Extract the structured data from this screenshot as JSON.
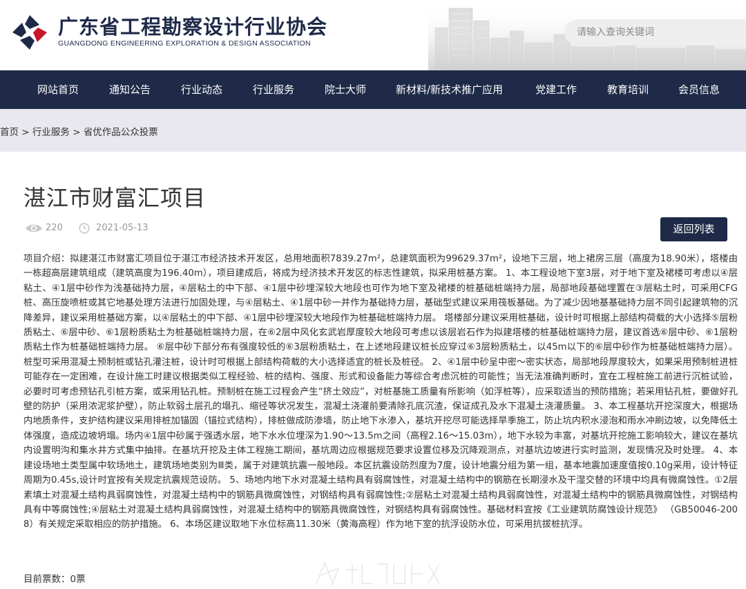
{
  "header": {
    "org_name_cn": "广东省工程勘察设计行业协会",
    "org_name_en": "GUANGDONG ENGINEERING EXPLORATION & DESIGN ASSOCIATION",
    "logo_icon": "association-logo",
    "search_placeholder": "请输入查询关键词"
  },
  "nav": {
    "items": [
      {
        "label": "网站首页"
      },
      {
        "label": "通知公告"
      },
      {
        "label": "行业动态"
      },
      {
        "label": "行业服务"
      },
      {
        "label": "院士大师"
      },
      {
        "label": "新材料/新技术推广应用"
      },
      {
        "label": "党建工作"
      },
      {
        "label": "教育培训"
      },
      {
        "label": "会员信息"
      }
    ]
  },
  "breadcrumb": {
    "items": [
      "首页",
      "行业服务",
      "省优作品公众投票"
    ],
    "separator": " > "
  },
  "article": {
    "title": "湛江市财富汇项目",
    "views": "220",
    "date": "2021-05-13",
    "back_label": "返回列表",
    "body": "项目介绍：拟建湛江市财富汇项目位于湛江市经济技术开发区，总用地面积7839.27m²，总建筑面积为99629.37m²，设地下三层，地上裙房三层（高度为18.90米），塔楼由一栋超高层建筑组成（建筑高度为196.40m），项目建成后，将成为经济技术开发区的标志性建筑，拟采用桩基方案。 1、本工程设地下室3层，对于地下室及裙楼可考虑以④层粘土、④1层中砂作为浅基础持力层，④层粘土的中下部、④1层中砂埋深较大地段也可作为地下室及裙楼的桩基础桩端持力层，局部地段基础埋置在③层粘土时，可采用CFG桩、高压旋喷桩或其它地基处理方法进行加固处理，与④层粘土、④1层中砂一并作为基础持力层，基础型式建议采用筏板基础。为了减少因地基基础持力层不同引起建筑物的沉降差异，建议采用桩基础方案，以④层粘土的中下部、④1层中砂埋深较大地段作为桩基础桩端持力层。 塔楼部分建议采用桩基础，设计时可根据上部结构荷载的大小选择⑤层粉质粘土、⑥层中砂、⑥1层粉质粘土为桩基础桩端持力层，在⑥2层中风化玄武岩厚度较大地段可考虑以该层岩石作为拟建塔楼的桩基础桩端持力层，建议首选⑥层中砂、⑥1层粉质粘土作为桩基础桩端持力层。 ⑥层中砂下部分布有强度较低的⑥3层粉质粘土，在上述地段建议桩长应穿过⑥3层粉质粘土，以45m以下的⑥层中砂作为桩基础桩端持力层）。桩型可采用混凝土预制桩或钻孔灌注桩，设计时可根据上部结构荷载的大小选择适宜的桩长及桩径。 2、④1层中砂呈中密～密实状态，局部地段厚度较大，如果采用预制桩进桩可能存在一定困难，在设计施工时建议根据类似工程经验、桩的结构、强度、形式和设备能力等综合考虑沉桩的可能性；当无法准确判断时，宜在工程桩施工前进行沉桩试验，必要时可考虑预钻孔引桩方案，或采用钻孔桩。预制桩在施工过程会产生“挤土效应”，对桩基施工质量有所影响（如浮桩等），应采取适当的预防措施；若采用钻孔桩，要做好孔壁的防护（采用浓泥浆护壁），防止软弱土层孔的塌孔、缩径等状况发生，混凝土浇灌前要清除孔底沉渣，保证成孔及水下混凝土浇灌质量。 3、本工程基坑开挖深度大，根据场内地质条件，支护结构建议采用排桩加锚固（锚拉式结构），排桩做成防渗墙，防止地下水渗入，基坑开挖尽可能选择旱季施工，防止坑内积水浸泡和雨水冲刷边坡，以免降低土体强度，造成边坡坍塌。场内④1层中砂属于强透水层，地下水水位埋深为1.90～13.5m之间（高程2.16～15.03m），地下水较为丰富，对基坑开挖施工影响较大，建议在基坑内设置明沟和集水井方式集中抽排。在基坑开挖及主体工程施工期间，基坑周边应根据规范要求设置位移及沉降观测点，对基坑边坡进行实时监测，发现情况及时处理。 4、本建设场地土类型属中软场地土，建筑场地类别为Ⅲ类，属于对建筑抗震一般地段。本区抗震设防烈度为7度，设计地震分组为第一组，基本地震加速度值按0.10g采用，设计特征周期为0.45s,设计时宜按有关规定抗震规范设防。 5、场地内地下水对混凝土结构具有弱腐蚀性，对混凝土结构中的钢筋在长期浸水及干湿交替的环境中均具有微腐蚀性。①2层素填土对混凝土结构具弱腐蚀性，对混凝土结构中的钢筋具微腐蚀性，对钢结构具有弱腐蚀性;②层粘土对混凝土结构具弱腐蚀性，对混凝土结构中的钢筋具微腐蚀性，对钢结构具有中等腐蚀性;④层粘土对混凝土结构具弱腐蚀性，对混凝土结构中的钢筋具微腐蚀性，对钢结构具有弱腐蚀性。基础材料宜按《工业建筑防腐蚀设计规范》 （GB50046-2008）有关规定采取相应的防护措施。 6、本场区建议取地下水位标高11.30米（黄海高程）作为地下室的抗浮设防水位，可采用抗拔桩抗浮。",
    "votes_label": "目前票数：0票"
  },
  "icons": {
    "views": "eye-icon",
    "date": "clock-icon"
  },
  "colors": {
    "navy": "#1e2a48",
    "logo_red": "#c8162a",
    "band": "#e8e8ee"
  }
}
